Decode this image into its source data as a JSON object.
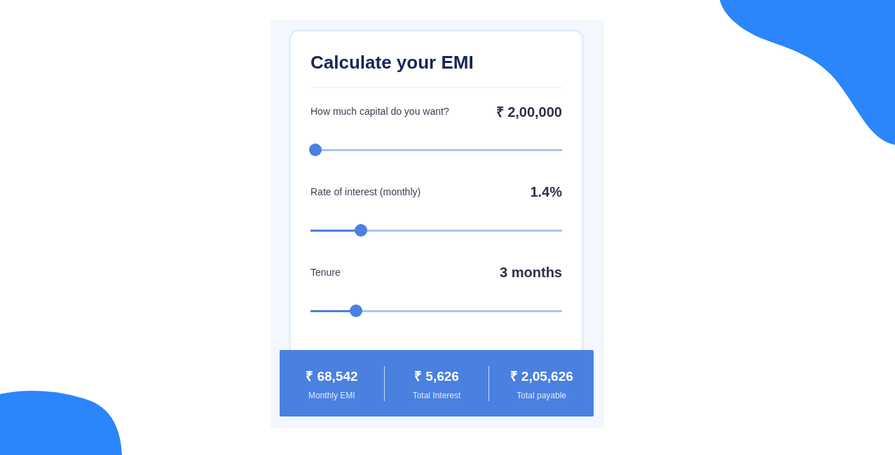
{
  "title": "Calculate your EMI",
  "sliders": [
    {
      "label": "How much capital do you want?",
      "value": "₹ 2,00,000",
      "level": 0.02
    },
    {
      "label": "Rate of interest (monthly)",
      "value": "1.4%",
      "level": 0.2
    },
    {
      "label": "Tenure",
      "value": "3 months",
      "level": 0.18
    }
  ],
  "summary": [
    {
      "value": "₹ 68,542",
      "label": "Monthly EMI"
    },
    {
      "value": "₹ 5,626",
      "label": "Total Interest"
    },
    {
      "value": "₹ 2,05,626",
      "label": "Total payable"
    }
  ]
}
